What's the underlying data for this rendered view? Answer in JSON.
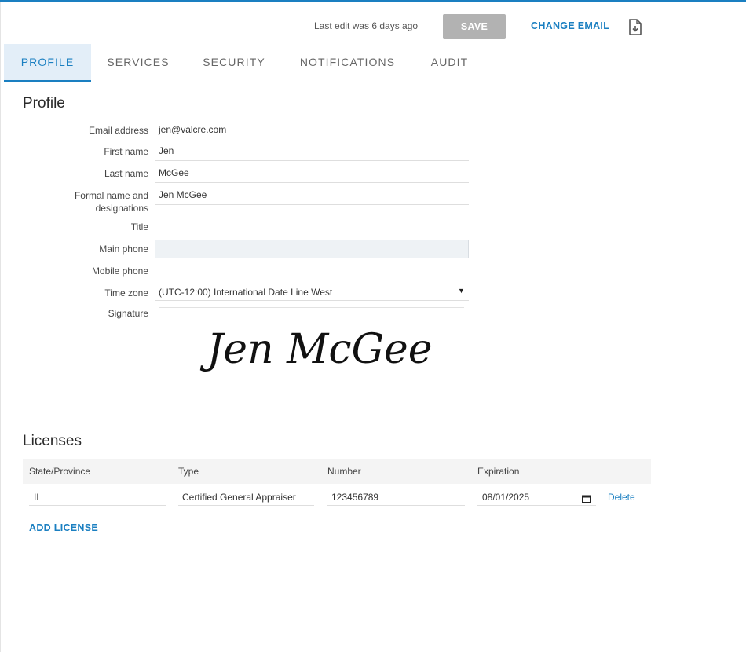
{
  "toolbar": {
    "last_edit": "Last edit was 6 days ago",
    "save_label": "SAVE",
    "change_email_label": "CHANGE EMAIL",
    "export_icon": "file-download-icon"
  },
  "tabs": [
    {
      "label": "PROFILE",
      "active": true
    },
    {
      "label": "SERVICES",
      "active": false
    },
    {
      "label": "SECURITY",
      "active": false
    },
    {
      "label": "NOTIFICATIONS",
      "active": false
    },
    {
      "label": "AUDIT",
      "active": false
    }
  ],
  "profile": {
    "title": "Profile",
    "fields": {
      "email": {
        "label": "Email address",
        "value": "jen@valcre.com"
      },
      "first_name": {
        "label": "First name",
        "value": "Jen"
      },
      "last_name": {
        "label": "Last name",
        "value": "McGee"
      },
      "formal_name": {
        "label": "Formal name and designations",
        "value": "Jen McGee"
      },
      "title": {
        "label": "Title",
        "value": ""
      },
      "main_phone": {
        "label": "Main phone",
        "value": ""
      },
      "mobile_phone": {
        "label": "Mobile phone",
        "value": ""
      },
      "time_zone": {
        "label": "Time zone",
        "value": "(UTC-12:00) International Date Line West"
      },
      "signature": {
        "label": "Signature",
        "value": "Jen McGee"
      }
    }
  },
  "licenses": {
    "title": "Licenses",
    "columns": [
      "State/Province",
      "Type",
      "Number",
      "Expiration"
    ],
    "rows": [
      {
        "state": "IL",
        "type": "Certified General Appraiser",
        "number": "123456789",
        "expiration": "08/01/2025",
        "delete_label": "Delete"
      }
    ],
    "add_label": "ADD LICENSE"
  },
  "colors": {
    "accent": "#1a7fc1",
    "save_disabled": "#b2b2b2",
    "tab_active_bg": "#e3eef8"
  }
}
